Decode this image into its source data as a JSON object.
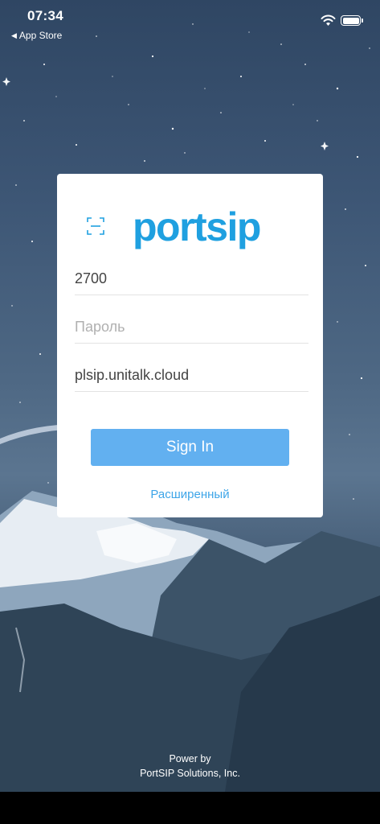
{
  "status_bar": {
    "time": "07:34",
    "back_label": "App Store",
    "back_arrow": "◀",
    "wifi_icon": "wifi-icon",
    "battery_icon": "battery-icon"
  },
  "login": {
    "logo_text": "portsip",
    "username_value": "2700",
    "password_placeholder": "Пароль",
    "domain_value": "plsip.unitalk.cloud",
    "signin_label": "Sign In",
    "advanced_label": "Расширенный",
    "scan_icon": "qr-scan-icon"
  },
  "footer": {
    "line1": "Power by",
    "line2": "PortSIP Solutions, Inc."
  },
  "colors": {
    "accent": "#1fa0e0",
    "button": "#62b0f0",
    "link": "#3da5e8"
  }
}
